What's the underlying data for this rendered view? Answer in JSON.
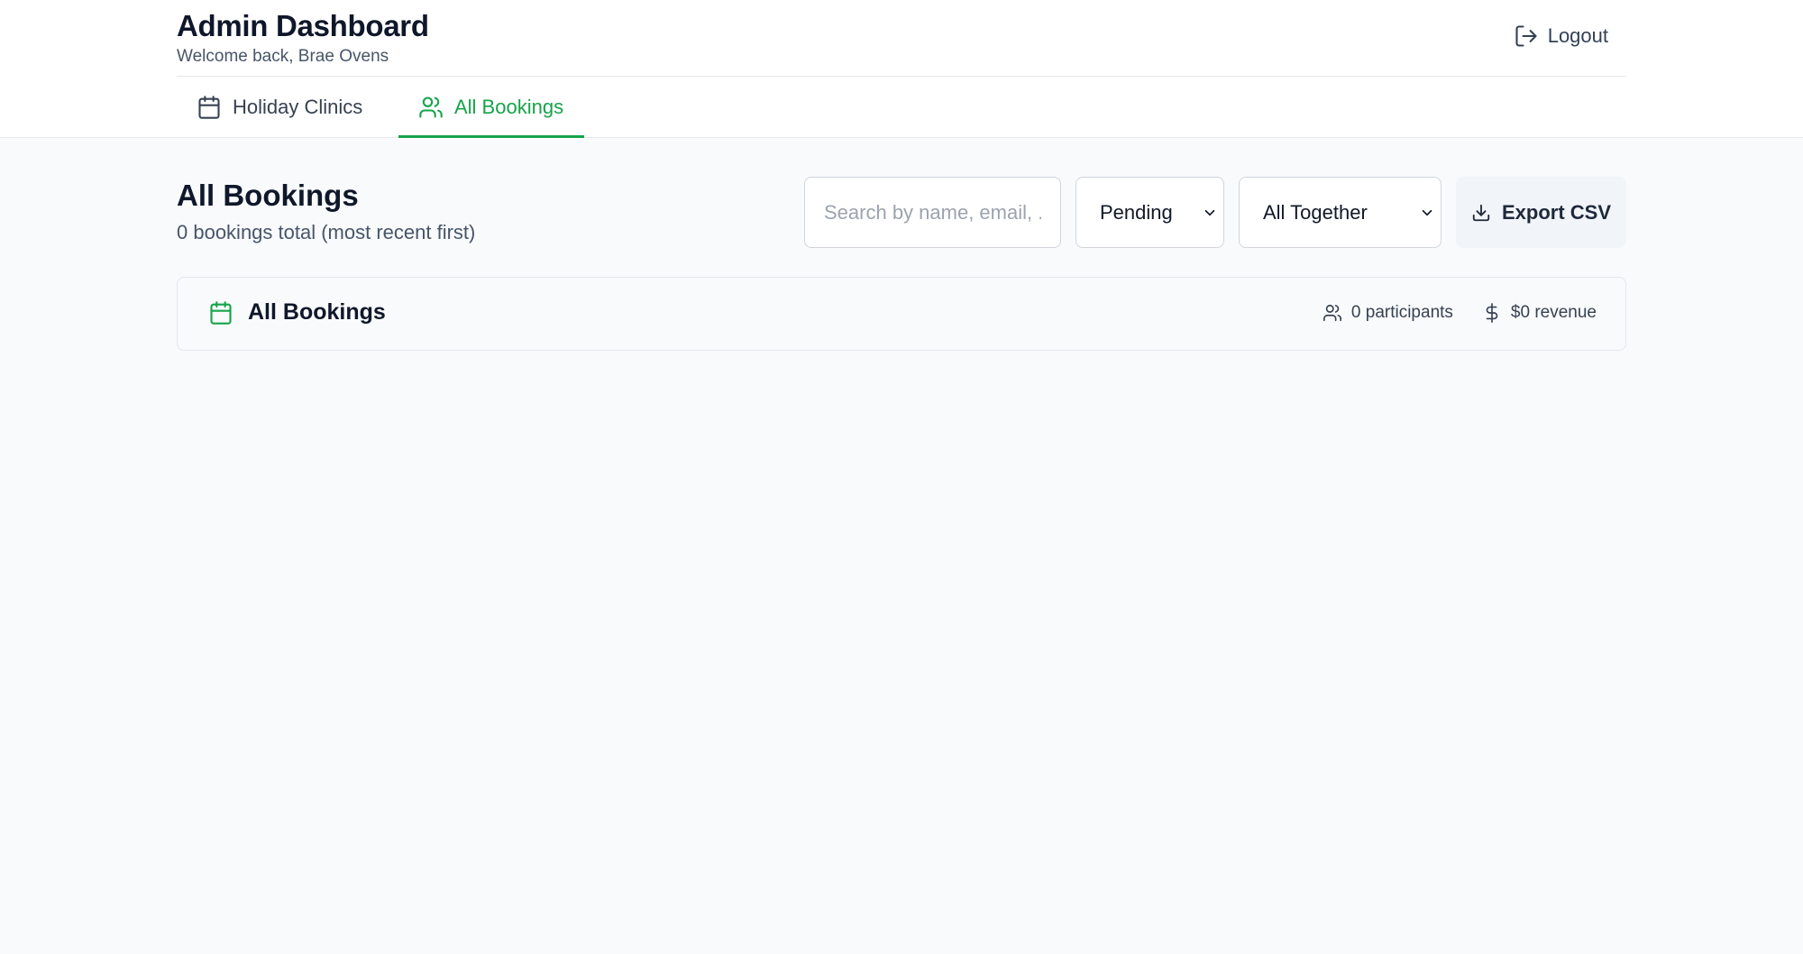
{
  "header": {
    "title": "Admin Dashboard",
    "welcome": "Welcome back, Brae Ovens",
    "logout_label": "Logout"
  },
  "tabs": [
    {
      "label": "Holiday Clinics",
      "icon": "calendar-icon",
      "active": false
    },
    {
      "label": "All Bookings",
      "icon": "users-icon",
      "active": true
    }
  ],
  "main": {
    "title": "All Bookings",
    "subtitle": "0 bookings total (most recent first)",
    "search": {
      "placeholder": "Search by name, email, ...",
      "value": ""
    },
    "status_filter": {
      "selected": "Pending"
    },
    "group_filter": {
      "selected": "All Together"
    },
    "export_label": "Export CSV"
  },
  "summary_card": {
    "title": "All Bookings",
    "participants": "0 participants",
    "revenue": "$0 revenue"
  },
  "colors": {
    "accent": "#16a34a",
    "background": "#f8fafc",
    "text": "#0f172a"
  }
}
